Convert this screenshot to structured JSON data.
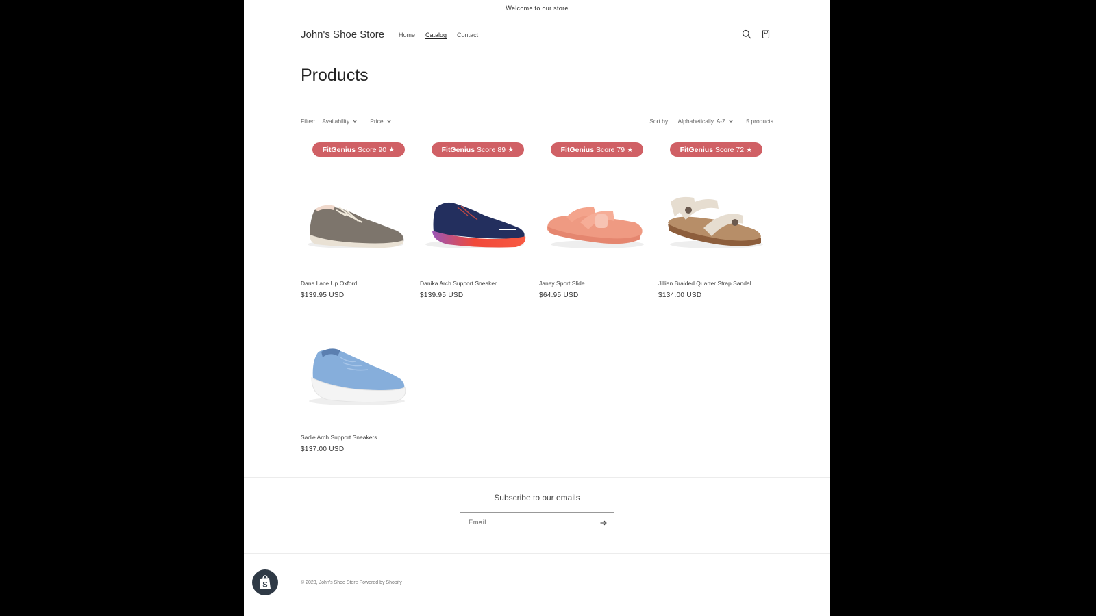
{
  "announcement": "Welcome to our store",
  "header": {
    "logo": "John's Shoe Store",
    "nav": [
      {
        "label": "Home",
        "active": false
      },
      {
        "label": "Catalog",
        "active": true
      },
      {
        "label": "Contact",
        "active": false
      }
    ],
    "icons": {
      "search": "search-icon",
      "cart": "cart-icon"
    }
  },
  "page_title": "Products",
  "filters": {
    "label": "Filter:",
    "options": [
      "Availability",
      "Price"
    ],
    "sort_label": "Sort by:",
    "sort_value": "Alphabetically, A-Z",
    "count": "5 products"
  },
  "products": [
    {
      "badge_brand": "FitGenius",
      "badge_text": "Score 90 ★",
      "name": "Dana Lace Up Oxford",
      "price": "$139.95 USD",
      "colors": {
        "upper": "#7d756c",
        "sole": "#e9e1d4",
        "accent": "#efe8da"
      }
    },
    {
      "badge_brand": "FitGenius",
      "badge_text": "Score 89 ★",
      "name": "Danika Arch Support Sneaker",
      "price": "$139.95 USD",
      "colors": {
        "upper": "#232f5e",
        "sole": "#f0493a",
        "accent": "#9a56b7"
      }
    },
    {
      "badge_brand": "FitGenius",
      "badge_text": "Score 79 ★",
      "name": "Janey Sport Slide",
      "price": "$64.95 USD",
      "colors": {
        "upper": "#f4a48c",
        "sole": "#ef9a82",
        "accent": "#f7c3b3"
      }
    },
    {
      "badge_brand": "FitGenius",
      "badge_text": "Score 72 ★",
      "name": "Jillian Braided Quarter Strap Sandal",
      "price": "$134.00 USD",
      "colors": {
        "upper": "#e6ddd0",
        "sole": "#8d5e3c",
        "accent": "#b78e68"
      }
    },
    {
      "badge_brand": null,
      "badge_text": null,
      "name": "Sadie Arch Support Sneakers",
      "price": "$137.00 USD",
      "colors": {
        "upper": "#86aedb",
        "sole": "#f4f4f4",
        "accent": "#5b7fb0"
      }
    }
  ],
  "badge_color": "#d06065",
  "newsletter": {
    "heading": "Subscribe to our emails",
    "placeholder": "Email"
  },
  "footer": {
    "copyright": "© 2023, John's Shoe Store Powered by Shopify"
  }
}
